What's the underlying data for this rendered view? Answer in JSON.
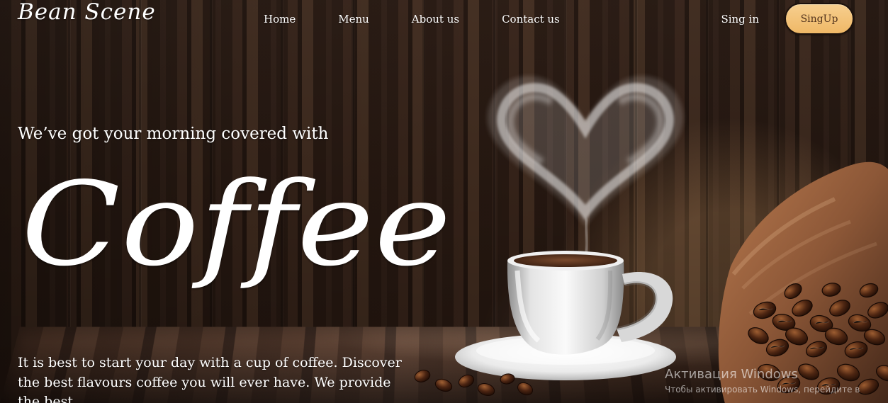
{
  "brand": {
    "logo": "Bean Scene"
  },
  "nav": {
    "links": [
      "Home",
      "Menu",
      "About us",
      "Contact us"
    ],
    "signin": "Sing in",
    "signup": "SingUp"
  },
  "hero": {
    "tagline": "We’ve got your morning covered with",
    "headline": "Coffee",
    "description": "It is best to start your day with a cup of coffee. Discover the best flavours coffee you will ever have. We provide the best"
  },
  "icons": {
    "steam": "heart-steam-icon",
    "cup": "coffee-cup-icon",
    "beans": "coffee-beans-icon"
  },
  "system": {
    "activation_title": "Активация Windows",
    "activation_text": "Чтобы активировать Windows, перейдите в"
  },
  "colors": {
    "button_fill": "#f2c27a",
    "button_text": "#52331d",
    "hero_text": "#ffffff"
  }
}
